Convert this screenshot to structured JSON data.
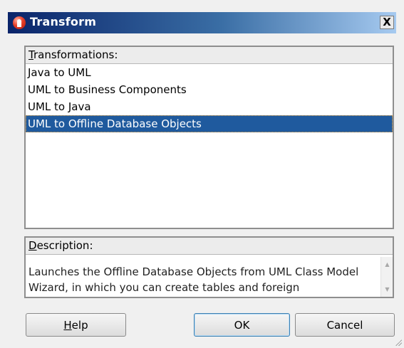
{
  "window": {
    "title": "Transform",
    "close_label": "X"
  },
  "transformations": {
    "header_underlined": "T",
    "header_rest": "ransformations:",
    "items": [
      "Java to UML",
      "UML to Business Components",
      "UML to Java",
      "UML to Offline Database Objects"
    ],
    "selected_index": 3
  },
  "description": {
    "header_underlined": "D",
    "header_rest": "escription:",
    "text": "Launches the Offline Database Objects from UML Class Model Wizard, in which you can create tables and foreign"
  },
  "buttons": {
    "help_underlined": "H",
    "help_rest": "elp",
    "ok": "OK",
    "cancel": "Cancel"
  },
  "icons": {
    "app": "oracle-app-icon",
    "close": "close-icon",
    "scroll_up": "scroll-up-icon",
    "scroll_down": "scroll-down-icon",
    "resize": "resize-grip-icon"
  },
  "colors": {
    "titlebar_start": "#0a246a",
    "selection": "#1f5a9e"
  }
}
